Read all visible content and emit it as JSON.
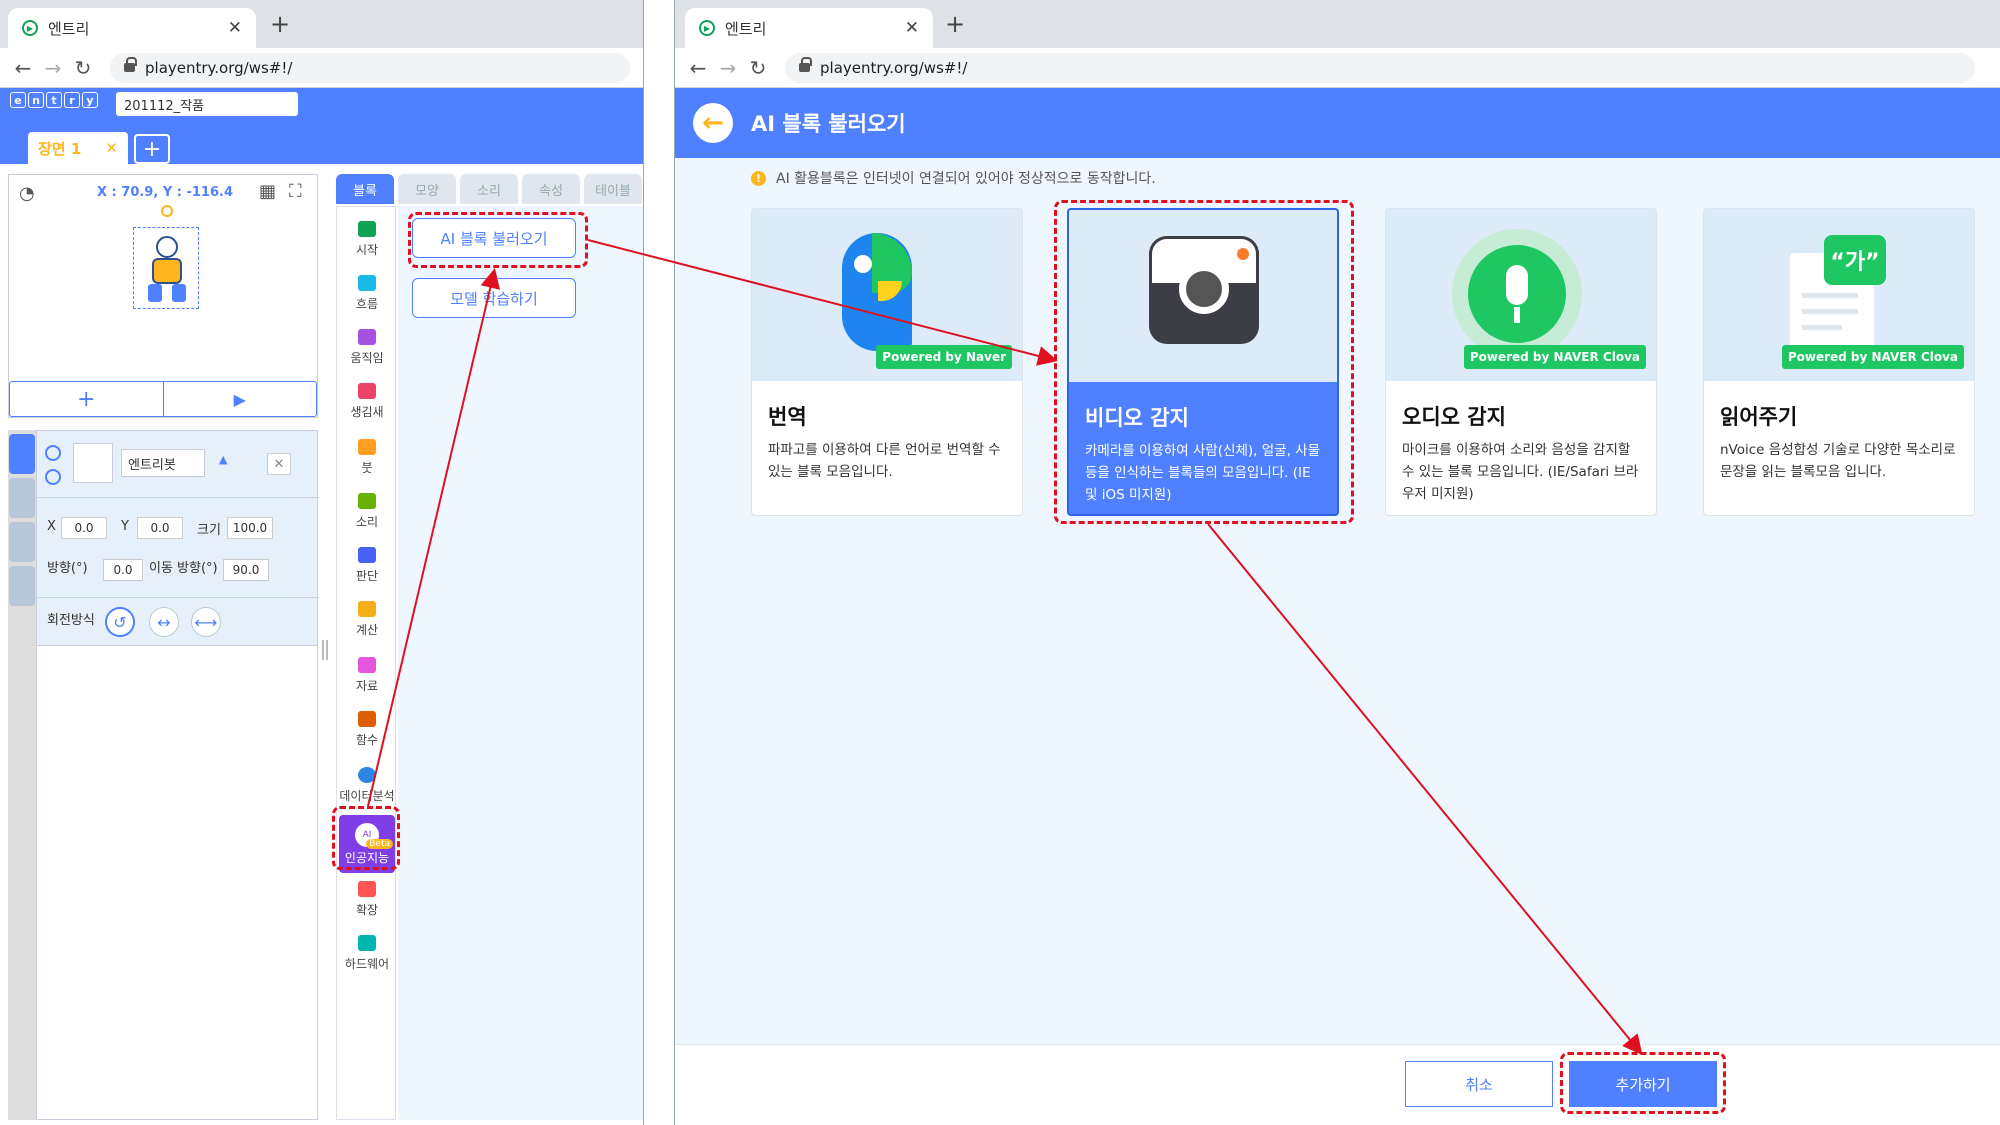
{
  "left_browser": {
    "tab_title": "엔트리",
    "url": "playentry.org/ws#!/"
  },
  "right_browser": {
    "tab_title": "엔트리",
    "url": "playentry.org/ws#!/"
  },
  "editor": {
    "logo_letters": [
      "e",
      "n",
      "t",
      "r",
      "y"
    ],
    "project_name": "201112_작품",
    "scene_tab": "장면 1",
    "scene_close": "✕",
    "scene_add": "+",
    "coord_readout": "X : 70.9,  Y : -116.4",
    "stage_add": "+",
    "stage_play": "▶",
    "object_name": "엔트리봇",
    "x_label": "X",
    "x_value": "0.0",
    "y_label": "Y",
    "y_value": "0.0",
    "size_label": "크기",
    "size_value": "100.0",
    "direction_label": "방향(°)",
    "direction_value": "0.0",
    "move_direction_label": "이동 방향(°)",
    "move_direction_value": "90.0",
    "rotation_label": "회전방식"
  },
  "block_tabs": [
    "블록",
    "모양",
    "소리",
    "속성",
    "테이블"
  ],
  "categories": [
    {
      "label": "시작",
      "color": "#0fa354"
    },
    {
      "label": "흐름",
      "color": "#19baea"
    },
    {
      "label": "움직임",
      "color": "#a751e3"
    },
    {
      "label": "생김새",
      "color": "#ec4466"
    },
    {
      "label": "붓",
      "color": "#ff9e20"
    },
    {
      "label": "소리",
      "color": "#67b100"
    },
    {
      "label": "판단",
      "color": "#4562f5"
    },
    {
      "label": "계산",
      "color": "#f4af18"
    },
    {
      "label": "자료",
      "color": "#e457dc"
    },
    {
      "label": "함수",
      "color": "#de5c04"
    },
    {
      "label": "데이터분석",
      "color": "#2d86e6"
    },
    {
      "label": "인공지능",
      "color": "#7f3ee6"
    },
    {
      "label": "확장",
      "color": "#ff5454"
    },
    {
      "label": "하드웨어",
      "color": "#00b6b1"
    }
  ],
  "beta_badge": "Beta",
  "ai_circle_text": "AI",
  "block_buttons": {
    "load_ai": "AI 블록 불러오기",
    "train_model": "모델 학습하기"
  },
  "ai_dialog": {
    "back_arrow": "←",
    "title": "AI 블록 불러오기",
    "notice_icon": "!",
    "notice": "AI 활용블록은 인터넷이 연결되어 있어야 정상적으로 동작합니다.",
    "cards": [
      {
        "title": "번역",
        "desc": "파파고를 이용하여 다른 언어로 번역할 수 있는 블록 모음입니다.",
        "badge": "Powered by Naver",
        "selected": false
      },
      {
        "title": "비디오 감지",
        "desc": "카메라를 이용하여 사람(신체), 얼굴, 사물 등을 인식하는 블록들의 모음입니다. (IE 및 iOS 미지원)",
        "badge": "",
        "selected": true
      },
      {
        "title": "오디오 감지",
        "desc": "마이크를 이용하여 소리와 음성을 감지할 수 있는 블록 모음입니다. (IE/Safari 브라우저 미지원)",
        "badge": "Powered by NAVER Clova",
        "selected": false
      },
      {
        "title": "읽어주기",
        "desc": "nVoice 음성합성 기술로 다양한 목소리로 문장을 읽는 블록모음 입니다.",
        "badge": "Powered by NAVER Clova",
        "selected": false
      }
    ],
    "speech_bubble": "“가”",
    "cancel": "취소",
    "add": "추가하기"
  },
  "colors": {
    "entry_blue": "#4f80ff",
    "ai_purple": "#7f3ee6",
    "highlight_red": "#e0101e",
    "naver_green": "#1ec762"
  }
}
